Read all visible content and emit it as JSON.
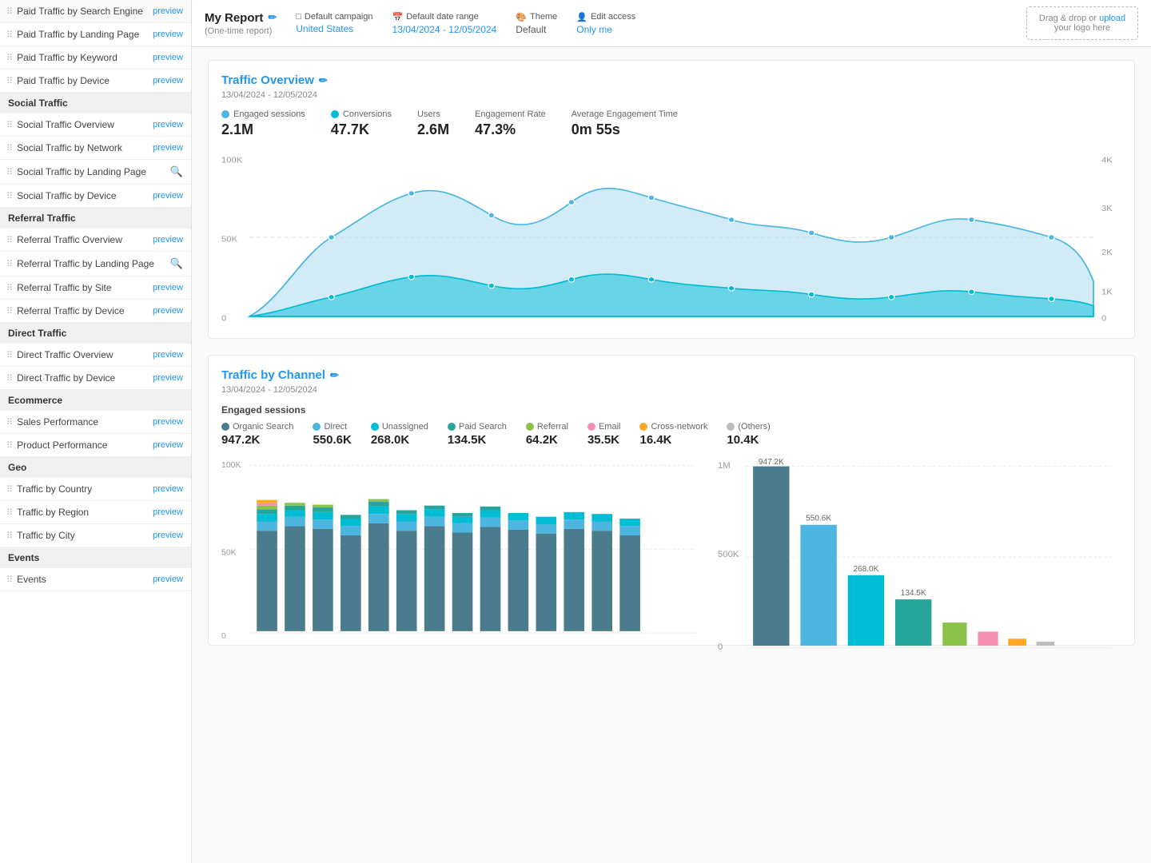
{
  "sidebar": {
    "sections": [
      {
        "label": "",
        "items": [
          {
            "label": "Paid Traffic by Search Engine",
            "action": "preview"
          },
          {
            "label": "Paid Traffic by Landing Page",
            "action": "preview"
          },
          {
            "label": "Paid Traffic by Keyword",
            "action": "preview"
          },
          {
            "label": "Paid Traffic by Device",
            "action": "preview"
          }
        ]
      },
      {
        "label": "Social Traffic",
        "items": [
          {
            "label": "Social Traffic Overview",
            "action": "preview"
          },
          {
            "label": "Social Traffic by Network",
            "action": "preview"
          },
          {
            "label": "Social Traffic by Landing Page",
            "action": "search"
          },
          {
            "label": "Social Traffic by Device",
            "action": "preview"
          }
        ]
      },
      {
        "label": "Referral Traffic",
        "items": [
          {
            "label": "Referral Traffic Overview",
            "action": "preview"
          },
          {
            "label": "Referral Traffic by Landing Page",
            "action": "search"
          },
          {
            "label": "Referral Traffic by Site",
            "action": "preview"
          },
          {
            "label": "Referral Traffic by Device",
            "action": "preview"
          }
        ]
      },
      {
        "label": "Direct Traffic",
        "items": [
          {
            "label": "Direct Traffic Overview",
            "action": "preview"
          },
          {
            "label": "Direct Traffic by Device",
            "action": "preview"
          }
        ]
      },
      {
        "label": "Ecommerce",
        "items": [
          {
            "label": "Sales Performance",
            "action": "preview"
          },
          {
            "label": "Product Performance",
            "action": "preview"
          }
        ]
      },
      {
        "label": "Geo",
        "items": [
          {
            "label": "Traffic by Country",
            "action": "preview"
          },
          {
            "label": "Traffic by Region",
            "action": "preview"
          },
          {
            "label": "Traffic by City",
            "action": "preview"
          }
        ]
      },
      {
        "label": "Events",
        "items": [
          {
            "label": "Events",
            "action": "preview"
          }
        ]
      }
    ]
  },
  "header": {
    "title": "My Report",
    "subtitle": "(One-time report)",
    "campaign_label": "Default campaign",
    "campaign_value": "United States",
    "date_label": "Default date range",
    "date_value": "13/04/2024 - 12/05/2024",
    "theme_label": "Theme",
    "theme_value": "Default",
    "access_label": "Edit access",
    "access_value": "Only me",
    "logo_text": "Drag & drop or upload your logo here"
  },
  "traffic_overview": {
    "title": "Traffic Overview",
    "date_range": "13/04/2024 - 12/05/2024",
    "metrics": [
      {
        "label": "Engaged sessions",
        "value": "2.1M",
        "dot_color": "#4db6e0"
      },
      {
        "label": "Conversions",
        "value": "47.7K",
        "dot_color": "#00bcd4"
      },
      {
        "label": "Users",
        "value": "2.6M",
        "dot_color": ""
      },
      {
        "label": "Engagement Rate",
        "value": "47.3%",
        "dot_color": ""
      },
      {
        "label": "Average Engagement Time",
        "value": "0m 55s",
        "dot_color": ""
      }
    ]
  },
  "traffic_by_channel": {
    "title": "Traffic by Channel",
    "date_range": "13/04/2024 - 12/05/2024",
    "section_label": "Engaged sessions",
    "channels": [
      {
        "label": "Organic Search",
        "value": "947.2K",
        "color": "#4a7c8e"
      },
      {
        "label": "Direct",
        "value": "550.6K",
        "color": "#4db6e0"
      },
      {
        "label": "Unassigned",
        "value": "268.0K",
        "color": "#00bcd4"
      },
      {
        "label": "Paid Search",
        "value": "134.5K",
        "color": "#26a69a"
      },
      {
        "label": "Referral",
        "value": "64.2K",
        "color": "#8bc34a"
      },
      {
        "label": "Email",
        "value": "35.5K",
        "color": "#f48fb1"
      },
      {
        "label": "Cross-network",
        "value": "16.4K",
        "color": "#ffa726"
      },
      {
        "label": "(Others)",
        "value": "10.4K",
        "color": "#bdbdbd"
      }
    ]
  },
  "icons": {
    "drag": "⠿",
    "pencil": "✏",
    "calendar": "📅",
    "user": "👤",
    "palette": "🎨",
    "lock": "🔒",
    "page": "📄"
  }
}
